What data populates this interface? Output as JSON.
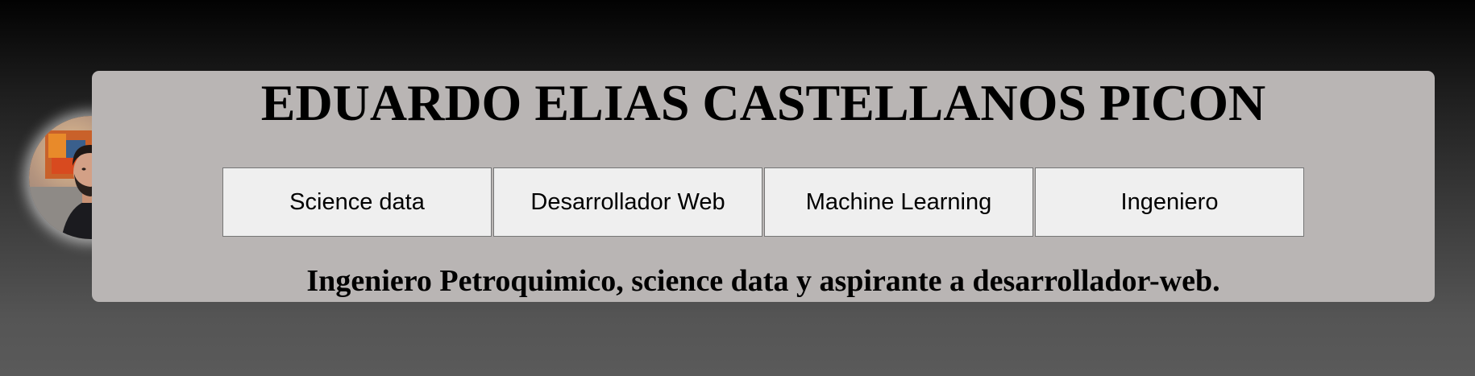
{
  "header": {
    "name": "EDUARDO ELIAS CASTELLANOS PICON",
    "tagline": "Ingeniero Petroquimico, science data y aspirante a desarrollador-web."
  },
  "nav": {
    "buttons": [
      {
        "label": "Science data"
      },
      {
        "label": "Desarrollador Web"
      },
      {
        "label": "Machine Learning"
      },
      {
        "label": "Ingeniero"
      }
    ]
  },
  "colors": {
    "card_background": "#b9b5b4",
    "button_background": "#efefef",
    "button_border": "#767676",
    "text": "#000000"
  },
  "icons": {
    "avatar": "profile-photo"
  }
}
